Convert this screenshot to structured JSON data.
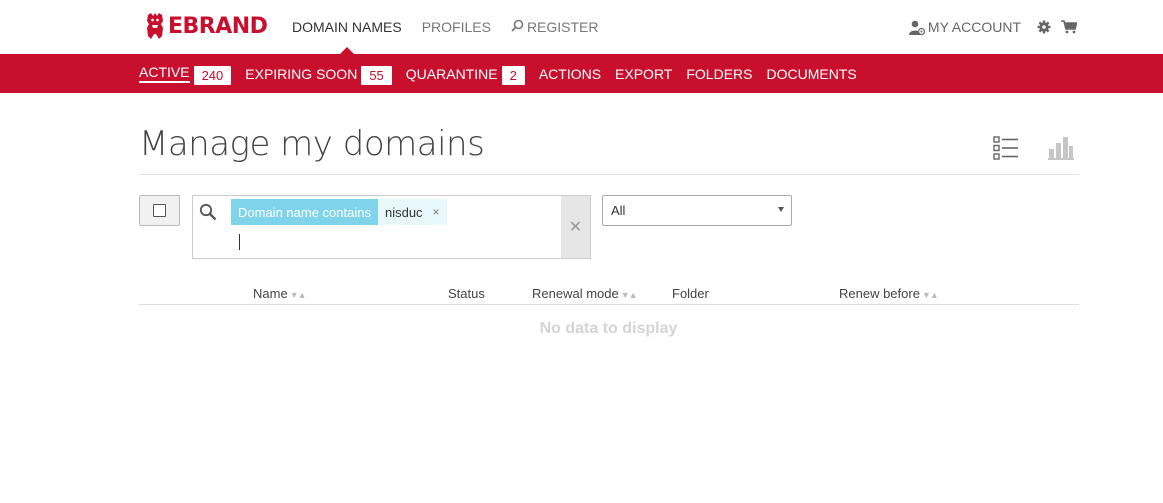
{
  "header": {
    "brand": "EBRAND",
    "nav": {
      "domain_names": "DOMAIN NAMES",
      "profiles": "PROFILES",
      "register": "REGISTER"
    },
    "account": "MY ACCOUNT",
    "icons": [
      "user-icon",
      "gear-icon",
      "cart-icon"
    ]
  },
  "subnav": {
    "active": {
      "label": "ACTIVE",
      "count": "240"
    },
    "expiring": {
      "label": "EXPIRING SOON",
      "count": "55"
    },
    "quarantine": {
      "label": "QUARANTINE",
      "count": "2"
    },
    "actions": "ACTIONS",
    "export": "EXPORT",
    "folders": "FOLDERS",
    "documents": "DOCUMENTS"
  },
  "page": {
    "title": "Manage my domains"
  },
  "filter": {
    "tag_key": "Domain name contains",
    "tag_value": "nisduc",
    "tag_remove": "×",
    "clear": "✕",
    "select_value": "All"
  },
  "table": {
    "columns": {
      "name": "Name",
      "status": "Status",
      "renewal_mode": "Renewal mode",
      "folder": "Folder",
      "renew_before": "Renew before"
    },
    "sort_glyph": "▼▲",
    "empty": "No data to display"
  },
  "colors": {
    "brand": "#c8102e",
    "tag": "#7fd3ea"
  }
}
